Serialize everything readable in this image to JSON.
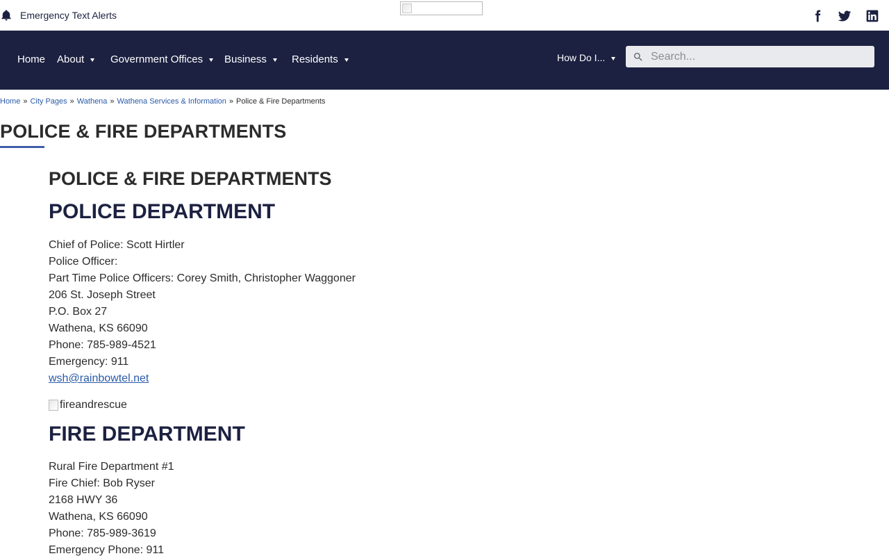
{
  "topbar": {
    "alert_label": "Emergency Text Alerts",
    "social": [
      "facebook-icon",
      "twitter-icon",
      "linkedin-icon"
    ]
  },
  "nav": {
    "items": [
      {
        "label": "Home",
        "dropdown": false
      },
      {
        "label": "About",
        "dropdown": true
      },
      {
        "label": "Government Offices",
        "dropdown": true
      },
      {
        "label": "Business",
        "dropdown": true
      },
      {
        "label": "Residents",
        "dropdown": true
      }
    ],
    "how_do_i": "How Do I...",
    "search_placeholder": "Search..."
  },
  "breadcrumb": {
    "items": [
      "Home",
      "City Pages",
      "Wathena",
      "Wathena Services & Information"
    ],
    "current": "Police & Fire Departments",
    "separator": "»"
  },
  "page_title": "POLICE & FIRE DEPARTMENTS",
  "content": {
    "heading": "POLICE & FIRE DEPARTMENTS",
    "police": {
      "title": "POLICE DEPARTMENT",
      "lines": [
        "Chief of Police: Scott Hirtler",
        "Police Officer:",
        "Part Time Police Officers: Corey Smith, Christopher Waggoner",
        "206 St. Joseph Street",
        "P.O. Box 27",
        "Wathena, KS 66090",
        "Phone: 785-989-4521",
        "Emergency: 911"
      ],
      "email": "wsh@rainbowtel.net"
    },
    "image_alt": "fireandrescue",
    "fire": {
      "title": "FIRE DEPARTMENT",
      "lines": [
        "Rural Fire Department #1",
        "Fire Chief: Bob Ryser",
        "2168 HWY 36",
        "Wathena, KS 66090",
        "Phone: 785-989-3619",
        "Emergency Phone: 911"
      ]
    }
  },
  "colors": {
    "nav_bg": "#1c2141",
    "link": "#2a5aa8",
    "accent_underline": "#3f5ea8"
  }
}
